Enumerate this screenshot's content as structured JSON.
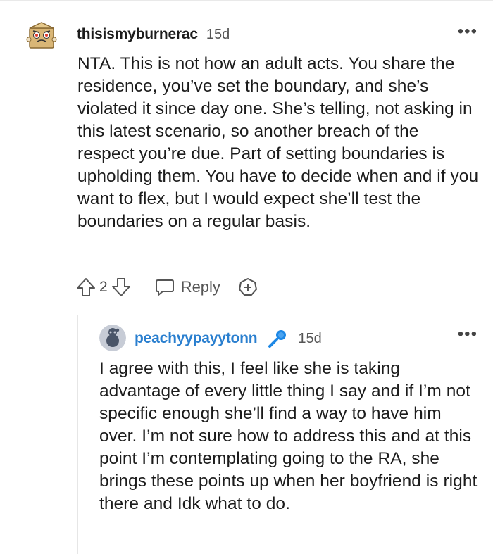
{
  "comment": {
    "username": "thisismyburnerac",
    "timestamp": "15d",
    "more_icon": "•••",
    "body": "NTA. This is not how an adult acts. You share the residence, you’ve set the boundary, and she’s violated it since day one. She’s telling, not asking in this latest scenario, so another breach of the respect you’re due. Part of setting boundaries is upholding them. You have to decide when and if you want to flex, but I would expect she’ll test the boundaries on a regular basis.",
    "vote_count": "2",
    "reply_label": "Reply",
    "avatar_icon": "snoo-box-avatar-icon"
  },
  "reply": {
    "username": "peachyypayytonn",
    "timestamp": "15d",
    "more_icon": "•••",
    "flair_icon": "microphone-icon",
    "body": "I agree with this, I feel like she is taking advantage of every little thing I say and if I’m not specific enough she’ll find a way to have him over. I’m not sure how to address this and at this point I’m contemplating going to the RA, she brings these points up when her boyfriend is right there and Idk what to do.",
    "avatar_icon": "default-snoo-avatar-icon"
  },
  "colors": {
    "reply_username": "#2a7fcf",
    "mic": "#1e88e5",
    "text": "#1c1c1c"
  }
}
